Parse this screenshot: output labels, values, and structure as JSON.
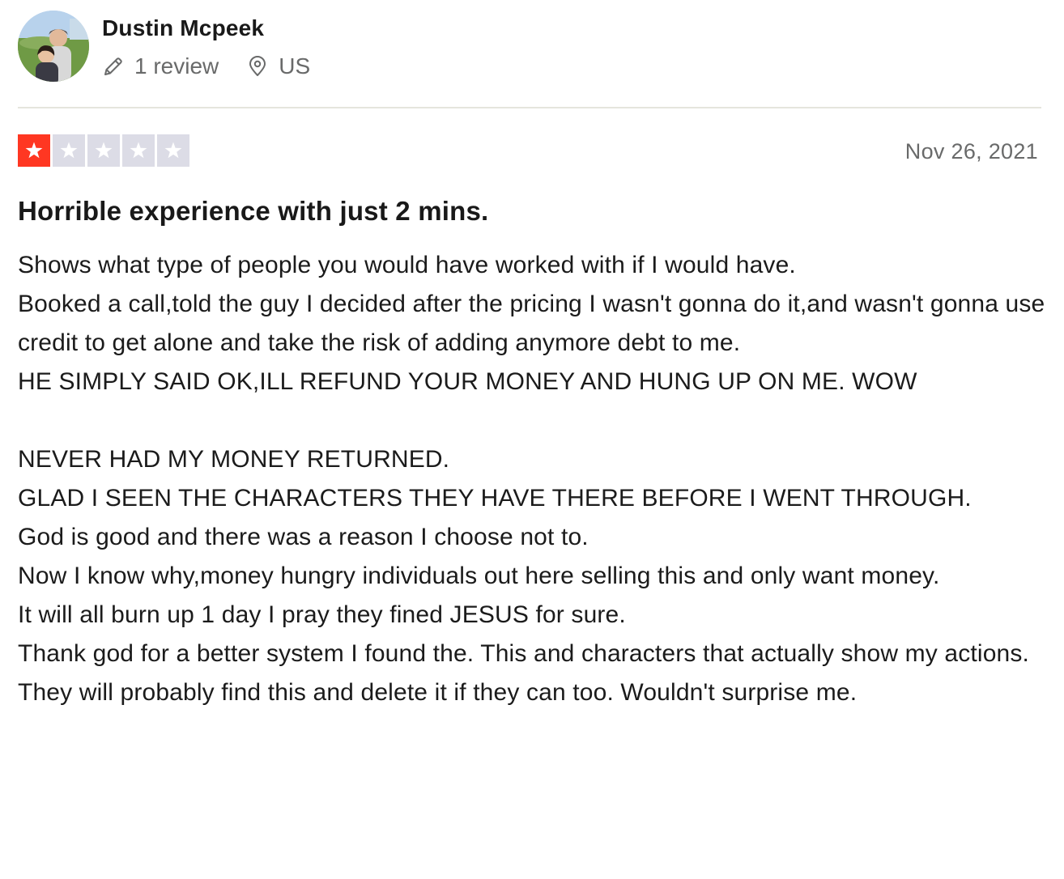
{
  "reviewer": {
    "name": "Dustin Mcpeek",
    "review_count": "1 review",
    "country": "US"
  },
  "review": {
    "rating": 1,
    "rating_max": 5,
    "date": "Nov 26, 2021",
    "title": "Horrible experience with just 2 mins.",
    "body_lines": [
      "Shows what type of people you would have worked with if I would have.",
      "Booked a call,told the guy I decided after the pricing I wasn't gonna do it,and wasn't gonna use credit to get alone and take the risk of adding anymore debt to me.",
      "HE SIMPLY SAID OK,ILL REFUND YOUR MONEY AND HUNG UP ON ME. WOW",
      "",
      "NEVER HAD MY MONEY RETURNED.",
      "GLAD I SEEN THE CHARACTERS THEY HAVE THERE BEFORE I WENT THROUGH.",
      "God is good and there was a reason I choose not to.",
      "Now I know why,money hungry individuals out here selling this and only want money.",
      "It will all burn up 1 day I pray they fined JESUS for sure.",
      "Thank god for a better system I found the. This and characters that actually show my actions.",
      "They will probably find this and delete it if they can too. Wouldn't surprise me."
    ]
  },
  "icons": {
    "review_count": "pencil-icon",
    "country": "location-pin-icon",
    "star": "star-icon"
  },
  "colors": {
    "star_filled": "#ff3722",
    "star_empty": "#dcdce6",
    "meta_text": "#696a6a"
  }
}
